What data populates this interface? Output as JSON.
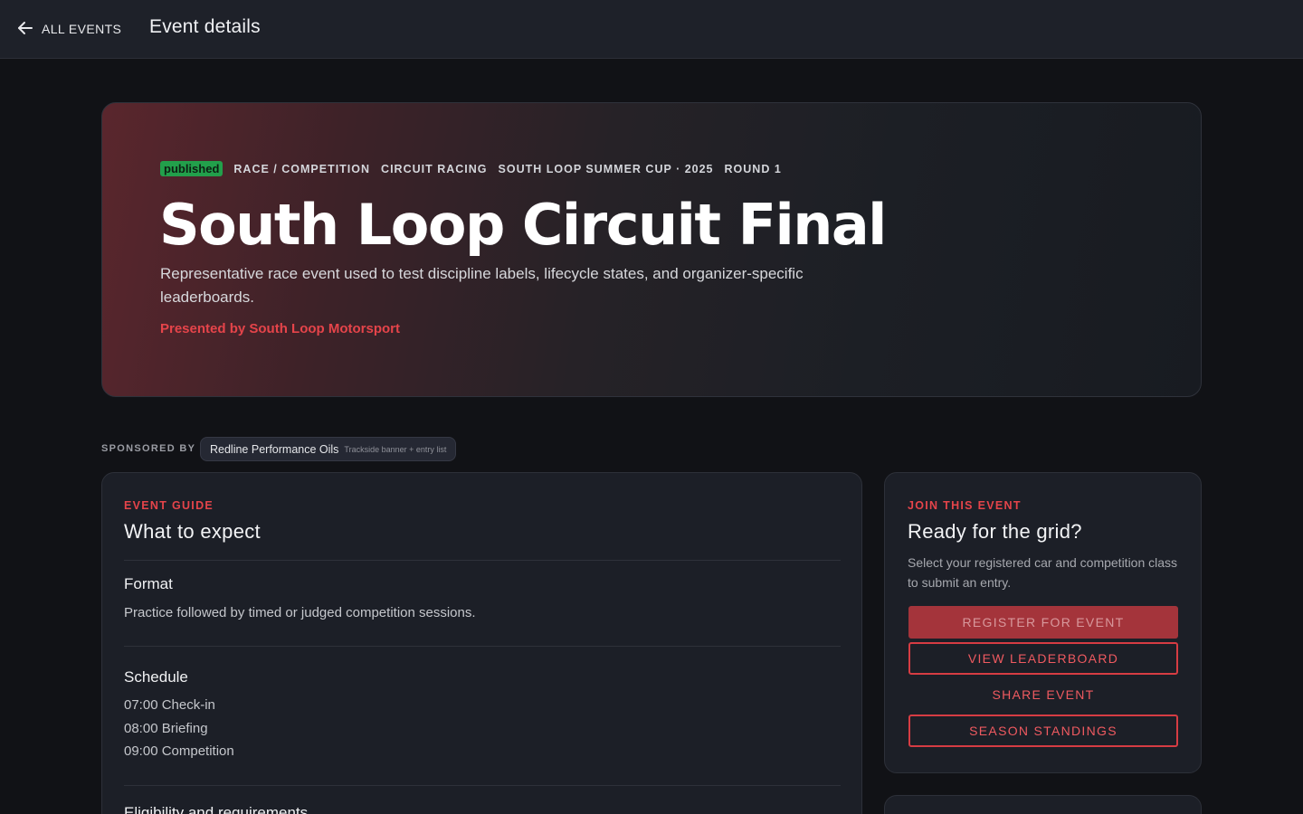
{
  "topbar": {
    "back_label": "ALL EVENTS",
    "back_icon": "arrow-left-icon",
    "title": "Event details"
  },
  "hero": {
    "status": "published",
    "status_color": "#22a04b",
    "tags": [
      "RACE / COMPETITION",
      "CIRCUIT RACING",
      "SOUTH LOOP SUMMER CUP · 2025",
      "ROUND 1"
    ],
    "title": "South Loop Circuit Final",
    "description": "Representative race event used to test discipline labels, lifecycle states, and organizer-specific leaderboards.",
    "presenter": "Presented by South Loop Motorsport",
    "accent_color": "#e5444a"
  },
  "sponsors": {
    "label": "SPONSORED BY",
    "items": [
      {
        "name": "Redline Performance Oils",
        "note": "Trackside banner + entry list"
      }
    ]
  },
  "guide": {
    "eyebrow": "EVENT GUIDE",
    "heading": "What to expect",
    "sections": [
      {
        "title": "Format",
        "lines": [
          "Practice followed by timed or judged competition sessions."
        ]
      },
      {
        "title": "Schedule",
        "lines": [
          "07:00 Check-in",
          "08:00 Briefing",
          "09:00 Competition"
        ]
      },
      {
        "title": "Eligibility and requirements",
        "lines": []
      }
    ]
  },
  "join": {
    "eyebrow": "JOIN THIS EVENT",
    "heading": "Ready for the grid?",
    "description": "Select your registered car and competition class to submit an entry.",
    "buttons": {
      "register": "REGISTER FOR EVENT",
      "leaderboard": "VIEW LEADERBOARD",
      "share": "SHARE EVENT",
      "standings": "SEASON STANDINGS"
    }
  }
}
